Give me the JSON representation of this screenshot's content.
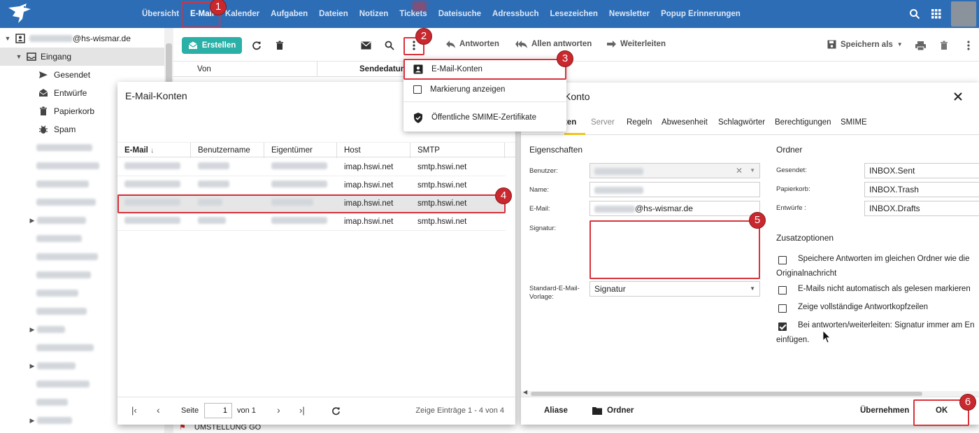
{
  "topnav": {
    "items": [
      "Übersicht",
      "E-Mail",
      "Kalender",
      "Aufgaben",
      "Dateien",
      "Notizen",
      "Tickets",
      "Dateisuche",
      "Adressbuch",
      "Lesezeichen",
      "Newsletter",
      "Popup Erinnerungen"
    ],
    "active": "E-Mail"
  },
  "sidebar": {
    "account_suffix": "@hs-wismar.de",
    "inbox": "Eingang",
    "folders": [
      "Gesendet",
      "Entwürfe",
      "Papierkorb",
      "Spam"
    ]
  },
  "toolbar": {
    "create": "Erstellen",
    "reply": "Antworten",
    "reply_all": "Allen antworten",
    "forward": "Weiterleiten",
    "save_as": "Speichern als"
  },
  "list_header": {
    "from": "Von",
    "sent_date": "Sendedatum"
  },
  "list_peek": "UMSTELLUNG GO",
  "menu": {
    "items": [
      "E-Mail-Konten",
      "Markierung anzeigen",
      "Öffentliche SMIME-Zertifikate"
    ]
  },
  "accounts_dialog": {
    "title": "E-Mail-Konten",
    "columns": [
      "E-Mail",
      "Benutzername",
      "Eigentümer",
      "Host",
      "SMTP"
    ],
    "rows": [
      {
        "host": "imap.hswi.net",
        "smtp": "smtp.hswi.net"
      },
      {
        "host": "imap.hswi.net",
        "smtp": "smtp.hswi.net"
      },
      {
        "host": "imap.hswi.net",
        "smtp": "smtp.hswi.net"
      },
      {
        "host": "imap.hswi.net",
        "smtp": "smtp.hswi.net"
      }
    ],
    "pager": {
      "page_label": "Seite",
      "page_value": "1",
      "of_label": "von 1",
      "summary": "Zeige Einträge 1 - 4 von 4"
    }
  },
  "account_dialog": {
    "title_visible": "Konto",
    "tabs": [
      "Konten",
      "Server",
      "Regeln",
      "Abwesenheit",
      "Schlagwörter",
      "Berechtigungen",
      "SMIME"
    ],
    "tab_first_visible": "ten",
    "properties_heading": "Eigenschaften",
    "labels": {
      "user": "Benutzer:",
      "name": "Name:",
      "email": "E-Mail:",
      "signature": "Signatur:",
      "template": "Standard-E-Mail-Vorlage:"
    },
    "email_suffix": "@hs-wismar.de",
    "template_value": "Signatur",
    "folder_heading": "Ordner",
    "folder_labels": {
      "sent": "Gesendet:",
      "trash": "Papierkorb:",
      "drafts": "Entwürfe :"
    },
    "folder_values": {
      "sent": "INBOX.Sent",
      "trash": "INBOX.Trash",
      "drafts": "INBOX.Drafts"
    },
    "extra_heading": "Zusatzoptionen",
    "options": [
      {
        "line1": "Speichere Antworten im gleichen Ordner wie die",
        "line2": "Originalnachricht",
        "checked": false
      },
      {
        "line1": "E-Mails nicht automatisch als gelesen markieren",
        "line2": "",
        "checked": false
      },
      {
        "line1": "Zeige vollständige Antwortkopfzeilen",
        "line2": "",
        "checked": false
      },
      {
        "line1": "Bei antworten/weiterleiten: Signatur immer am En",
        "line2": "einfügen.",
        "checked": true
      }
    ],
    "footer": {
      "aliases": "Aliase",
      "folder": "Ordner",
      "apply": "Übernehmen",
      "ok": "OK"
    }
  },
  "annotations": [
    "1",
    "2",
    "3",
    "4",
    "5",
    "6"
  ],
  "colors": {
    "topbar": "#2c6db5",
    "accent": "#2ab0a6",
    "annotation": "#d9323a"
  }
}
